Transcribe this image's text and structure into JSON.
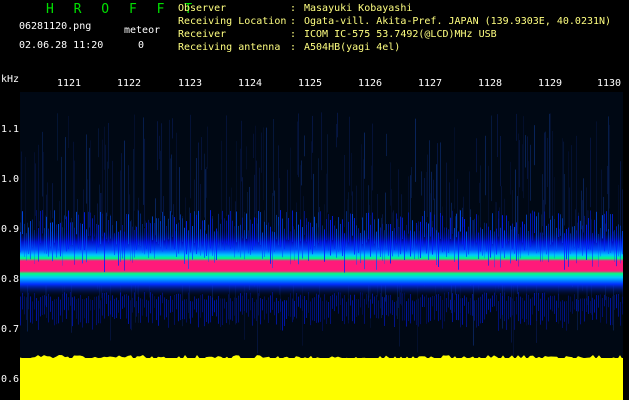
{
  "header": {
    "app_title": "H R O F F T",
    "file_name": "06281120.png",
    "datetime": "02.06.28 11:20",
    "meteor_label": "meteor",
    "meteor_count": "0"
  },
  "info": [
    {
      "label": "Observer",
      "sep": ":",
      "value": "Masayuki Kobayashi"
    },
    {
      "label": "Receiving Location",
      "sep": ":",
      "value": "Ogata-vill. Akita-Pref. JAPAN (139.9303E, 40.0231N)"
    },
    {
      "label": "Receiver",
      "sep": ":",
      "value": "ICOM IC-575 53.7492(@LCD)MHz USB"
    },
    {
      "label": "Receiving antenna",
      "sep": ":",
      "value": "A504HB(yagi 4el)"
    }
  ],
  "time_axis": {
    "labels": [
      "1121",
      "1122",
      "1123",
      "1124",
      "1125",
      "1126",
      "1127",
      "1128",
      "1129",
      "1130"
    ]
  },
  "freq_axis": {
    "unit": "kHz",
    "labels": [
      "1.1",
      "1.0",
      "0.9",
      "0.8",
      "0.7",
      "0.6"
    ]
  },
  "colors": {
    "noise": "#000814",
    "band_blue": "#0018ff",
    "band_cyan": "#00c8ff",
    "band_green": "#00ff80",
    "band_core": "#ff1a7a",
    "floor": "#ffff00"
  }
}
